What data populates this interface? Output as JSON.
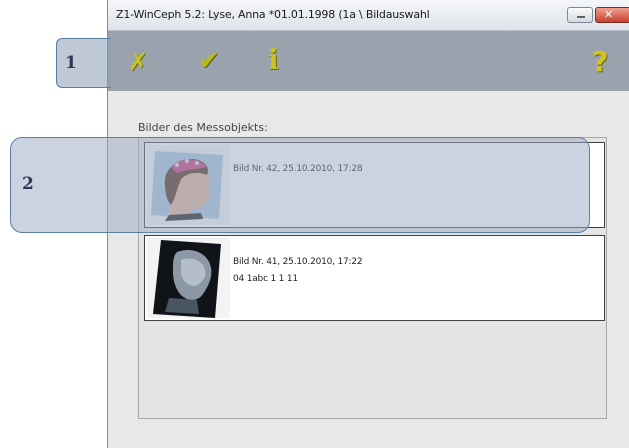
{
  "window": {
    "title": "Z1-WinCeph 5.2: Lyse, Anna *01.01.1998 (1a \\ Bildauswahl",
    "close_glyph": "✕"
  },
  "toolbar": {
    "cancel_glyph": "✗",
    "ok_glyph": "✔",
    "info_glyph": "i",
    "help_glyph": "?"
  },
  "main": {
    "label": "Bilder des Messobjekts:",
    "images": [
      {
        "lines": [
          "Bild Nr. 42, 25.10.2010, 17:28"
        ]
      },
      {
        "lines": [
          "Bild Nr. 41, 25.10.2010, 17:22",
          "04  1abc  1  1  11"
        ]
      }
    ]
  },
  "callouts": [
    "1",
    "2"
  ],
  "colors": {
    "toolbar_bg": "#9aa3ad",
    "icon_yellow": "#c9c419",
    "callout_border": "#5b7fa3",
    "callout_fill": "#8c9eb4"
  }
}
